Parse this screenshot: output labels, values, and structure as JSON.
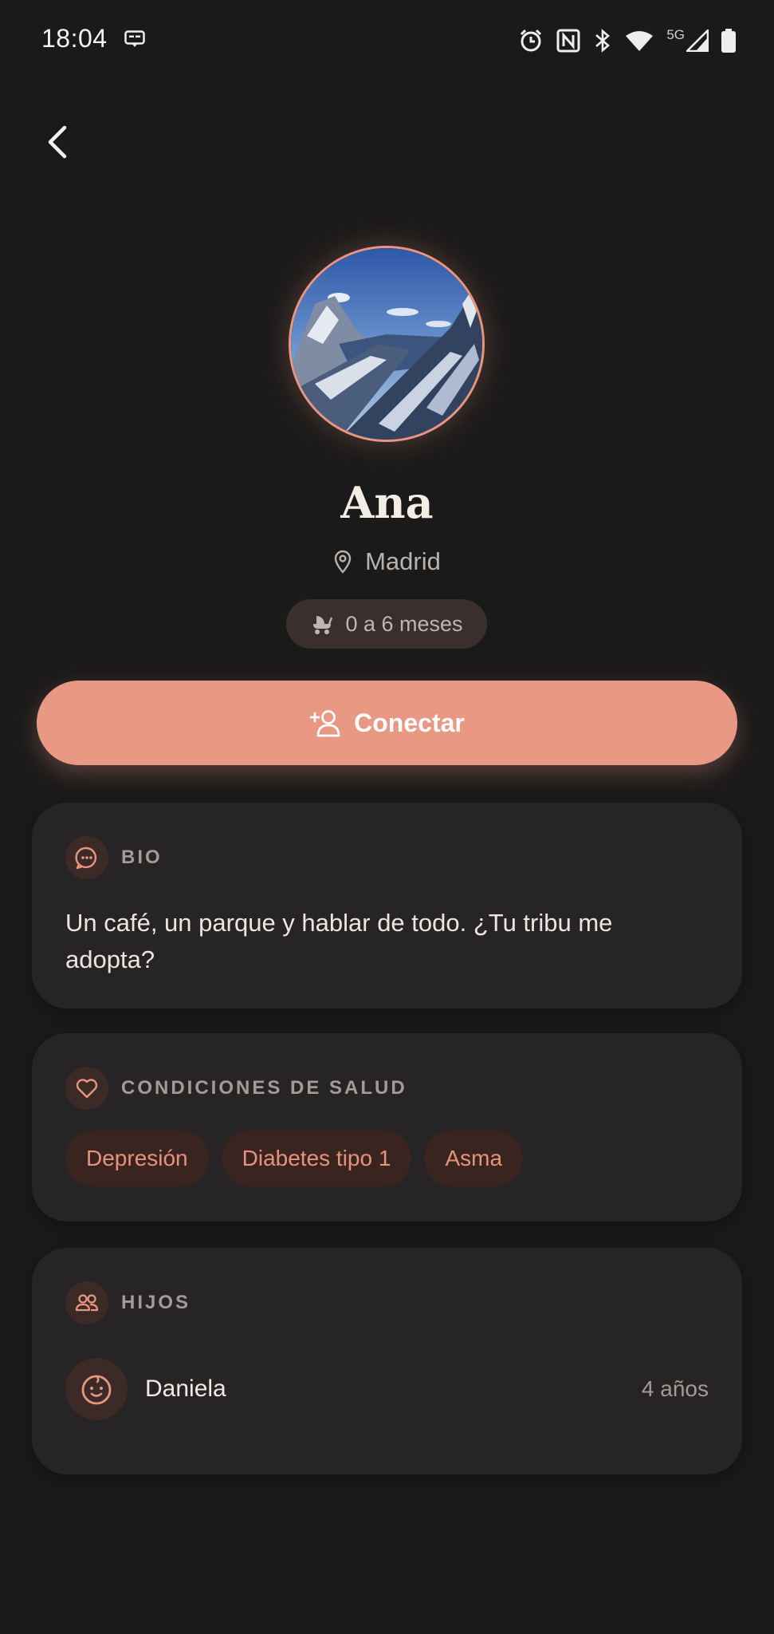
{
  "status_bar": {
    "time": "18:04",
    "network": "5G"
  },
  "profile": {
    "name": "Ana",
    "location": "Madrid",
    "baby_age": "0 a 6 meses"
  },
  "actions": {
    "connect_label": "Conectar"
  },
  "bio": {
    "title": "BIO",
    "text": "Un café, un parque y hablar de todo. ¿Tu tribu me adopta?"
  },
  "health": {
    "title": "CONDICIONES DE SALUD",
    "conditions": [
      "Depresión",
      "Diabetes tipo 1",
      "Asma"
    ]
  },
  "children": {
    "title": "HIJOS",
    "items": [
      {
        "name": "Daniela",
        "age": "4 años"
      }
    ]
  },
  "colors": {
    "accent": "#e89883",
    "background": "#1b1a1a",
    "card": "#262424"
  },
  "icons": [
    "back-chevron-icon",
    "location-pin-icon",
    "stroller-icon",
    "add-user-icon",
    "chat-bubble-icon",
    "heart-icon",
    "people-icon",
    "baby-face-icon"
  ]
}
